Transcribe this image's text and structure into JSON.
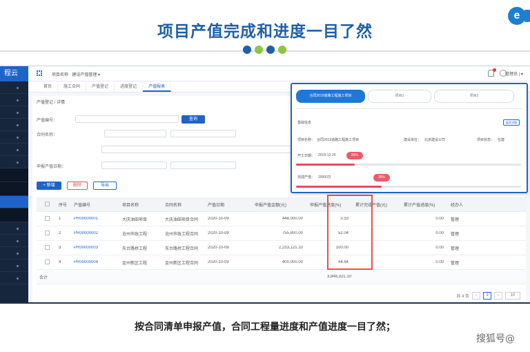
{
  "slide": {
    "title": "项目产值完成和进度一目了然",
    "caption": "按合同清单申报产值，合同工程量进度和产值进度一目了然；",
    "watermark": "搜狐号@",
    "dot_colors": [
      "#1f5fa8",
      "#8cc63f",
      "#1f5fa8",
      "#8cc63f"
    ]
  },
  "app": {
    "brand": "程云",
    "topbar": {
      "breadcrumb": "项目名称 · 建设产值管理 ▾",
      "user": "管理员 | ▾"
    },
    "tabs": [
      "首页",
      "施工合同",
      "产值登记",
      "进度登记",
      "产值报表"
    ],
    "content_breadcrumb": "产值登记 / 详情",
    "search_button": "查询",
    "toolbar": {
      "add": "+ 新增",
      "delete": "删除",
      "export": "导出"
    },
    "filter_labels": {
      "contract": "产值编号：",
      "group": "合同名称：",
      "range": "申报产值日期："
    },
    "columns": [
      "序号",
      "产值编号",
      "项目名称",
      "合同名称",
      "产值日期",
      "申报产值金额(元)",
      "申报产值进度(%)",
      "累计完成产值(元)",
      "累计产值进度(%)",
      "经办人",
      ""
    ],
    "rows": [
      {
        "no": "1",
        "code": "PR00000001",
        "project": "大庆油田项目",
        "contract": "大庆油田项目合同",
        "date": "2020-10-09",
        "amount": "448,000.00",
        "progress": "3.53",
        "cum_amount": "",
        "cum_progress": "0.00",
        "handler": "管理"
      },
      {
        "no": "2",
        "code": "PR00000002",
        "project": "沧州市政工程",
        "contract": "沧州市政工程合同",
        "date": "2020-10-09",
        "amount": "755,800.00",
        "progress": "52.04",
        "cum_amount": "",
        "cum_progress": "0.00",
        "handler": "管理"
      },
      {
        "no": "3",
        "code": "PR00000003",
        "project": "东台路桥工程",
        "contract": "东台路桥工程合同",
        "date": "2020-10-09",
        "amount": "2,233,121.10",
        "progress": "100.00",
        "cum_amount": "",
        "cum_progress": "0.00",
        "handler": "管理"
      },
      {
        "no": "4",
        "code": "PR00000004",
        "project": "金州新区工程",
        "contract": "金州新区工程合同",
        "date": "2020-10-09",
        "amount": "400,000.00",
        "progress": "44.64",
        "cum_amount": "",
        "cum_progress": "0.00",
        "handler": "管理"
      }
    ],
    "total_label": "合计",
    "total_amount": "3,848,321.10",
    "pager": {
      "total": "共 4 条",
      "page": "1",
      "size": "10"
    }
  },
  "popup": {
    "tabs": [
      "合同2019道路工程施工项目",
      "项目1",
      "项目2"
    ],
    "section": "基础信息",
    "edit_button": "展开详情",
    "project_label": "项目名称：",
    "project_value": "合同2019道路工程施工项目",
    "owner_label": "建设单位：",
    "owner_value": "北京建设公司",
    "status_label": "项目状态：",
    "status_value": "在建",
    "start_label": "开工日期：",
    "start_value": "2019-12-20",
    "start_progress": 0.26,
    "start_badge": "26%",
    "value_label": "完成产值：",
    "value_value": "20000万",
    "value_progress": 0.38,
    "value_badge": "38%"
  }
}
